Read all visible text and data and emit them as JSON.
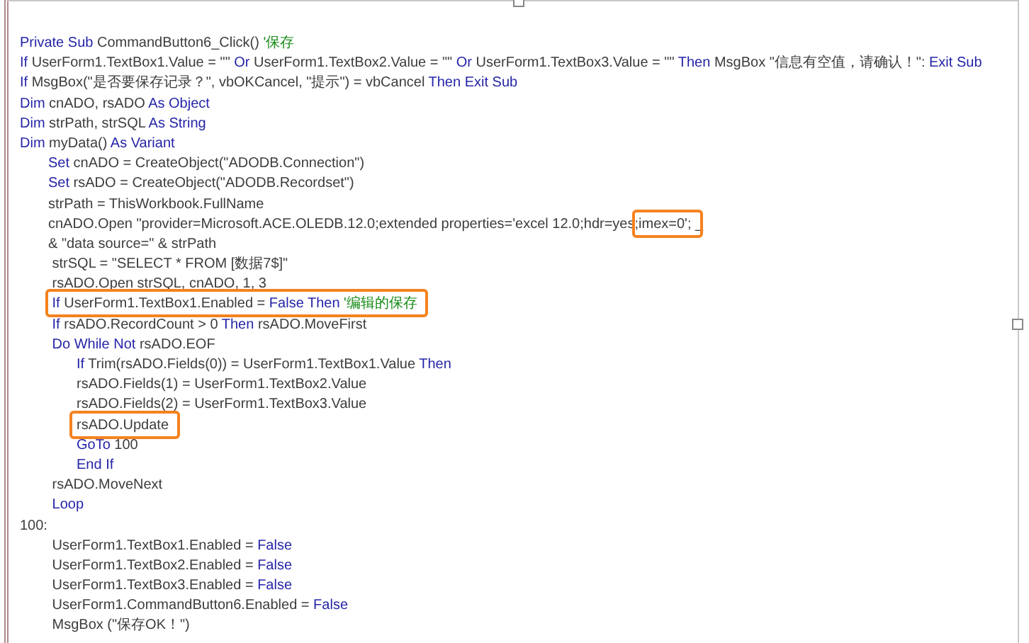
{
  "code_lines": [
    {
      "tokens": [
        {
          "text": "Private Sub",
          "kind": "keyword"
        },
        {
          "text": " CommandButton6_Click() ",
          "kind": "plain"
        },
        {
          "text": "'保存",
          "kind": "comment"
        }
      ]
    },
    {
      "tokens": [
        {
          "text": "If",
          "kind": "keyword"
        },
        {
          "text": " UserForm1.TextBox1.Value = \"\" ",
          "kind": "plain"
        },
        {
          "text": "Or",
          "kind": "keyword"
        },
        {
          "text": " UserForm1.TextBox2.Value = \"\" ",
          "kind": "plain"
        },
        {
          "text": "Or",
          "kind": "keyword"
        },
        {
          "text": " UserForm1.TextBox3.Value = \"\" ",
          "kind": "plain"
        },
        {
          "text": "Then",
          "kind": "keyword"
        },
        {
          "text": " MsgBox \"信息有空值，请确认！\": ",
          "kind": "plain"
        },
        {
          "text": "Exit Sub",
          "kind": "keyword"
        }
      ]
    },
    {
      "tokens": [
        {
          "text": "If",
          "kind": "keyword"
        },
        {
          "text": " MsgBox(\"是否要保存记录？\", vbOKCancel, \"提示\") = vbCancel ",
          "kind": "plain"
        },
        {
          "text": "Then Exit Sub",
          "kind": "keyword"
        }
      ]
    },
    {
      "tokens": [
        {
          "text": "Dim",
          "kind": "keyword"
        },
        {
          "text": " cnADO, rsADO ",
          "kind": "plain"
        },
        {
          "text": "As Object",
          "kind": "keyword"
        }
      ]
    },
    {
      "tokens": [
        {
          "text": "Dim",
          "kind": "keyword"
        },
        {
          "text": " strPath, strSQL ",
          "kind": "plain"
        },
        {
          "text": "As String",
          "kind": "keyword"
        }
      ]
    },
    {
      "tokens": [
        {
          "text": "Dim",
          "kind": "keyword"
        },
        {
          "text": " myData() ",
          "kind": "plain"
        },
        {
          "text": "As Variant",
          "kind": "keyword"
        }
      ]
    },
    {
      "tokens": [
        {
          "text": "\tSet",
          "kind": "keyword"
        },
        {
          "text": " cnADO = CreateObject(\"ADODB.Connection\")",
          "kind": "plain"
        }
      ]
    },
    {
      "tokens": [
        {
          "text": "\tSet",
          "kind": "keyword"
        },
        {
          "text": " rsADO = CreateObject(\"ADODB.Recordset\")",
          "kind": "plain"
        }
      ]
    },
    {
      "tokens": [
        {
          "text": "\tstrPath = ThisWorkbook.FullName",
          "kind": "plain"
        }
      ]
    },
    {
      "tokens": [
        {
          "text": "\tcnADO.Open \"provider=Microsoft.ACE.OLEDB.12.0;extended properties='excel 12.0;hdr=yes;",
          "kind": "plain"
        },
        {
          "text": "imex=0';",
          "kind": "plain",
          "boxed": true
        },
        {
          "text": " _",
          "kind": "plain"
        }
      ]
    },
    {
      "tokens": [
        {
          "text": "\t& \"data source=\" & strPath",
          "kind": "plain"
        }
      ]
    },
    {
      "tokens": [
        {
          "text": "\t strSQL = \"SELECT * FROM [数据7$]\"",
          "kind": "plain"
        }
      ]
    },
    {
      "tokens": [
        {
          "text": "\t rsADO.Open strSQL, cnADO, 1, 3",
          "kind": "plain"
        }
      ]
    },
    {
      "tokens": [
        {
          "text": "\t If",
          "kind": "keyword",
          "boxed": true
        },
        {
          "text": " UserForm1.TextBox1.Enabled = ",
          "kind": "plain",
          "boxed": true
        },
        {
          "text": "False Then ",
          "kind": "keyword",
          "boxed": true
        },
        {
          "text": "'编辑的保存",
          "kind": "comment",
          "boxed": true
        }
      ]
    },
    {
      "tokens": [
        {
          "text": "\t If",
          "kind": "keyword"
        },
        {
          "text": " rsADO.RecordCount > 0 ",
          "kind": "plain"
        },
        {
          "text": "Then",
          "kind": "keyword"
        },
        {
          "text": " rsADO.MoveFirst",
          "kind": "plain"
        }
      ]
    },
    {
      "tokens": [
        {
          "text": "\t Do While Not",
          "kind": "keyword"
        },
        {
          "text": " rsADO.EOF",
          "kind": "plain"
        }
      ]
    },
    {
      "tokens": [
        {
          "text": "\t\tIf",
          "kind": "keyword"
        },
        {
          "text": " Trim(rsADO.Fields(0)) = UserForm1.TextBox1.Value ",
          "kind": "plain"
        },
        {
          "text": "Then",
          "kind": "keyword"
        }
      ]
    },
    {
      "tokens": [
        {
          "text": "\t\trsADO.Fields(1) = UserForm1.TextBox2.Value",
          "kind": "plain"
        }
      ]
    },
    {
      "tokens": [
        {
          "text": "\t\trsADO.Fields(2) = UserForm1.TextBox3.Value",
          "kind": "plain"
        }
      ]
    },
    {
      "tokens": [
        {
          "text": "\t\trsADO.Update",
          "kind": "plain",
          "boxed": true
        }
      ]
    },
    {
      "tokens": [
        {
          "text": "\t\tGoTo",
          "kind": "keyword"
        },
        {
          "text": " 100",
          "kind": "plain"
        }
      ]
    },
    {
      "tokens": [
        {
          "text": "\t\tEnd If",
          "kind": "keyword"
        }
      ]
    },
    {
      "tokens": [
        {
          "text": "\t rsADO.MoveNext",
          "kind": "plain"
        }
      ]
    },
    {
      "tokens": [
        {
          "text": "\t Loop",
          "kind": "keyword"
        }
      ]
    },
    {
      "tokens": [
        {
          "text": "100:",
          "kind": "plain"
        }
      ]
    },
    {
      "tokens": [
        {
          "text": "\t UserForm1.TextBox1.Enabled = ",
          "kind": "plain"
        },
        {
          "text": "False",
          "kind": "keyword"
        }
      ]
    },
    {
      "tokens": [
        {
          "text": "\t UserForm1.TextBox2.Enabled = ",
          "kind": "plain"
        },
        {
          "text": "False",
          "kind": "keyword"
        }
      ]
    },
    {
      "tokens": [
        {
          "text": "\t UserForm1.TextBox3.Enabled = ",
          "kind": "plain"
        },
        {
          "text": "False",
          "kind": "keyword"
        }
      ]
    },
    {
      "tokens": [
        {
          "text": "\t UserForm1.CommandButton6.Enabled = ",
          "kind": "plain"
        },
        {
          "text": "False",
          "kind": "keyword"
        }
      ]
    },
    {
      "tokens": [
        {
          "text": "\t MsgBox (\"保存OK！\")",
          "kind": "plain"
        }
      ]
    }
  ]
}
